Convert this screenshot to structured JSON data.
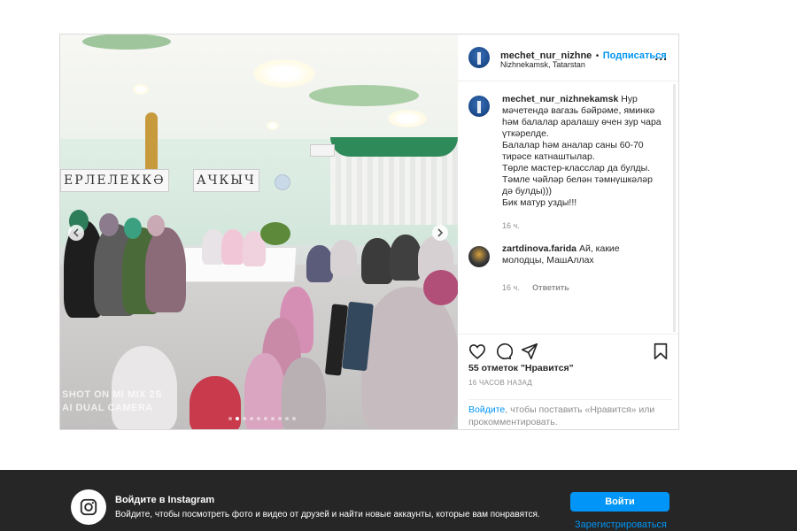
{
  "post": {
    "username": "mechet_nur_nizhne",
    "separator": "•",
    "follow_label": "Подписаться",
    "location": "Nizhnekamsk, Tatarstan",
    "more_label": "...",
    "image": {
      "banner_left": "ЕРЛЕЛЕККӘ",
      "banner_right": "АЧКЫЧ",
      "watermark_line1": "SHOT ON MI MIX 2S",
      "watermark_line2": "AI DUAL CAMERA"
    },
    "caption": {
      "author": "mechet_nur_nizhnekamsk",
      "text": "Нур мәчетендә вагазь бәйрәме, яминкә һәм балалар аралашу өчен зур чара үткәрелде.\nБалалар һәм аналар саны 60-70 тирәсе катнаштылар.\nТөрле мастер-класслар да булды.\nТәмле чәйләр белән тәмнүшкәләр дә булды)))\nБик матур узды!!!",
      "time": "16 ч."
    },
    "comments": [
      {
        "author": "zartdinova.farida",
        "text": "Ай, какие молодцы, МашАллах",
        "time": "16 ч.",
        "reply_label": "Ответить"
      }
    ],
    "likes": "55 отметок \"Нравится\"",
    "timestamp": "16 ЧАСОВ НАЗАД",
    "login_link": "Войдите",
    "login_rest": ", чтобы поставить «Нравится» или прокомментировать."
  },
  "bottom_bar": {
    "title": "Войдите в Instagram",
    "subtitle": "Войдите, чтобы посмотреть фото и видео от друзей и найти новые аккаунты, которые вам понравятся.",
    "login_button": "Войти",
    "signup_link": "Зарегистрироваться"
  },
  "colors": {
    "accent": "#0095f6",
    "bar_background": "#262626"
  },
  "icons": [
    "heart-icon",
    "comment-icon",
    "share-icon",
    "bookmark-icon",
    "instagram-icon",
    "more-icon",
    "chevron-left-icon",
    "chevron-right-icon"
  ]
}
